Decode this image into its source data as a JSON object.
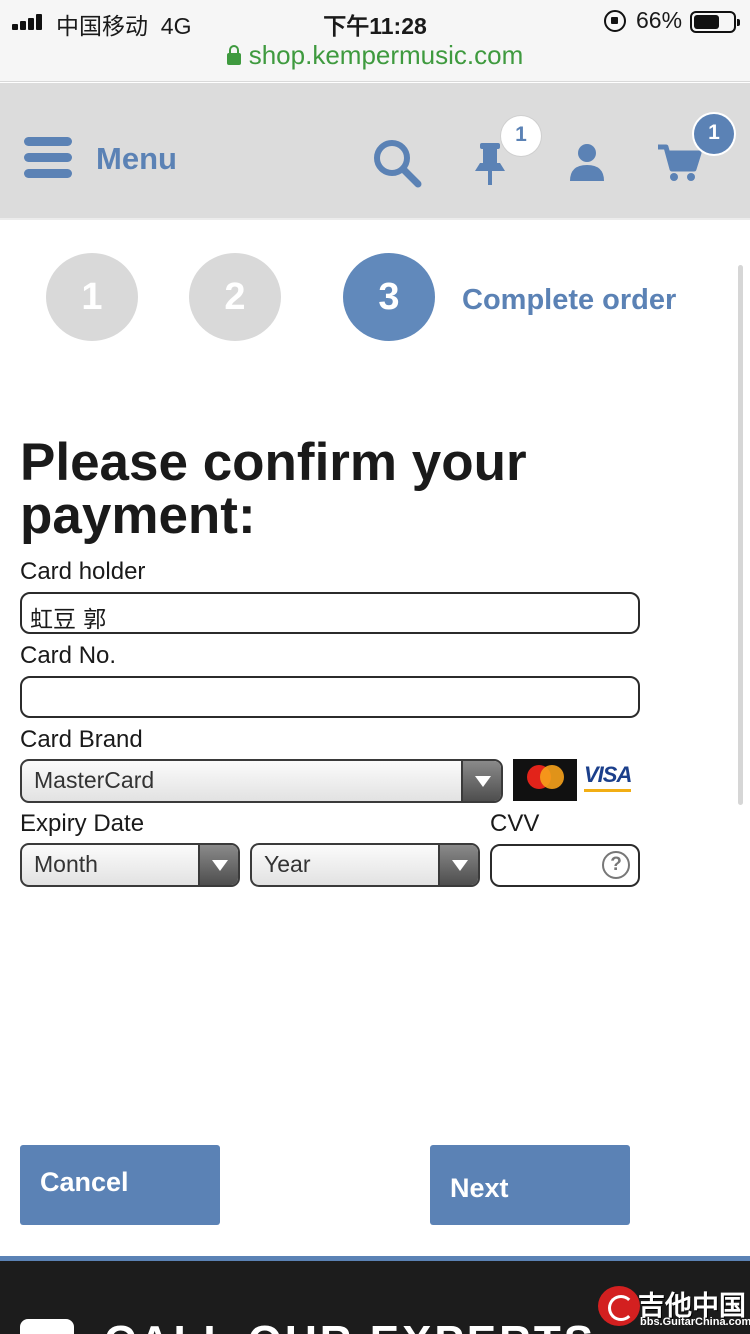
{
  "status_bar": {
    "carrier": "中国移动",
    "network": "4G",
    "time": "下午11:28",
    "battery_percent": "66%",
    "battery_level": 0.66,
    "url": "shop.kempermusic.com"
  },
  "header": {
    "menu_label": "Menu",
    "wishlist_badge": "1",
    "cart_badge": "1",
    "brand_color": "#5b82b5"
  },
  "steps": {
    "items": [
      "1",
      "2",
      "3"
    ],
    "active": 3,
    "active_label": "Complete order"
  },
  "form": {
    "title": "Please confirm your payment:",
    "card_holder_label": "Card holder",
    "card_holder_value": "虹豆 郭",
    "card_no_label": "Card No.",
    "card_no_value": "",
    "card_brand_label": "Card Brand",
    "card_brand_value": "MasterCard",
    "visa_text": "VISA",
    "expiry_label": "Expiry Date",
    "month_value": "Month",
    "year_value": "Year",
    "cvv_label": "CVV",
    "cvv_value": "",
    "cvv_help": "?"
  },
  "actions": {
    "cancel_label": "Cancel",
    "next_label": "Next"
  },
  "footer": {
    "text": "CALL OUR EXPERTS"
  },
  "watermark": {
    "name": "吉他中国",
    "url": "bbs.GuitarChina.com"
  }
}
